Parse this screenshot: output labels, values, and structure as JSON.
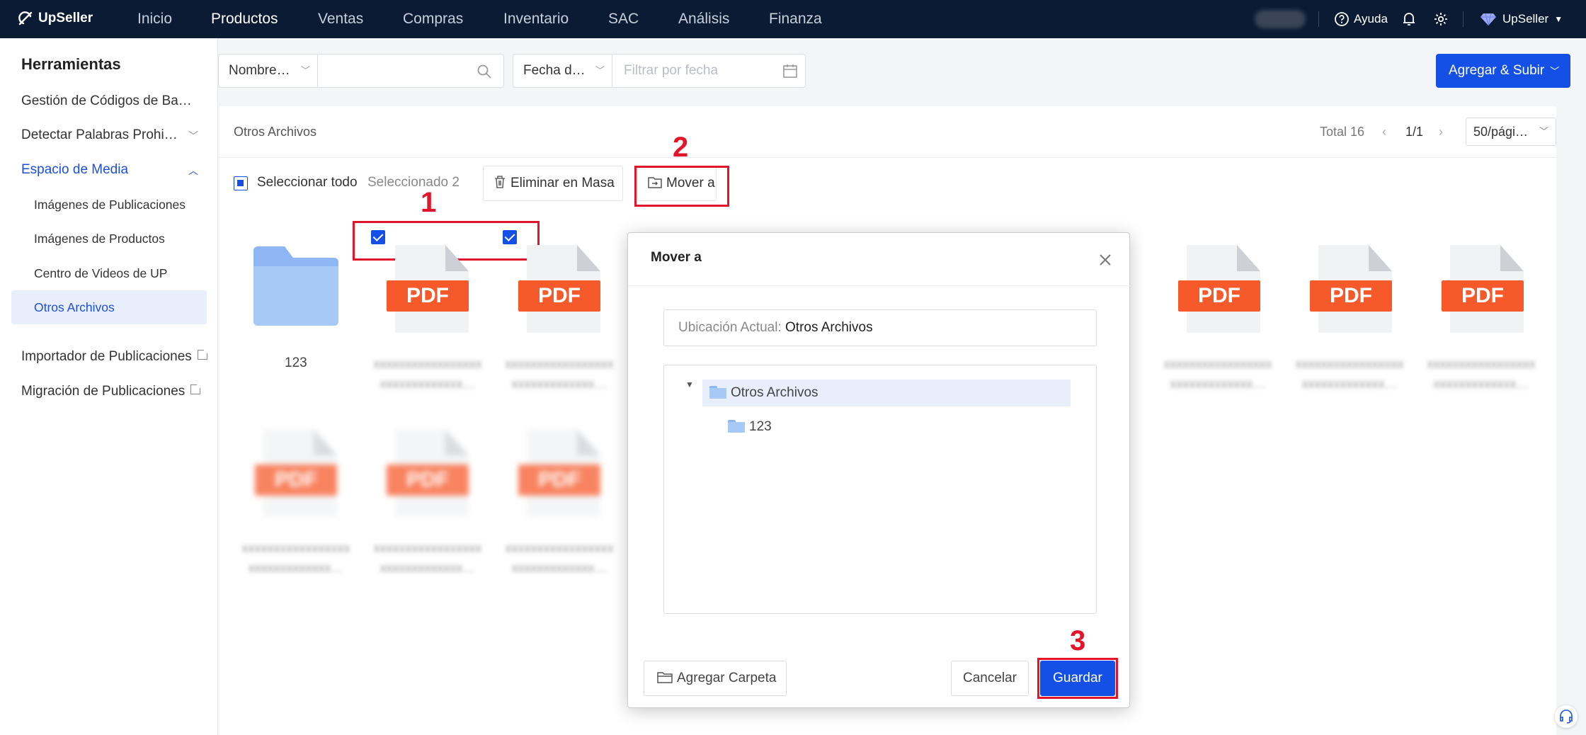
{
  "nav": {
    "brand": "UpSeller",
    "items": [
      {
        "label": "Inicio"
      },
      {
        "label": "Productos"
      },
      {
        "label": "Ventas"
      },
      {
        "label": "Compras"
      },
      {
        "label": "Inventario"
      },
      {
        "label": "SAC"
      },
      {
        "label": "Análisis"
      },
      {
        "label": "Finanza"
      }
    ],
    "active": "Productos",
    "help_label": "Ayuda",
    "account_label": "UpSeller"
  },
  "sidebar": {
    "title": "Herramientas",
    "items": [
      {
        "label": "Gestión de Códigos de Ba…"
      },
      {
        "label": "Detectar Palabras Prohi…"
      },
      {
        "label": "Espacio de Media"
      },
      {
        "label": "Importador de Publicaciones"
      },
      {
        "label": "Migración de Publicaciones"
      }
    ],
    "media_sub": [
      {
        "label": "Imágenes de Publicaciones"
      },
      {
        "label": "Imágenes de Productos"
      },
      {
        "label": "Centro de Videos de UP"
      },
      {
        "label": "Otros Archivos"
      }
    ]
  },
  "filters": {
    "name_select": "Nombre…",
    "date_select": "Fecha d…",
    "date_placeholder": "Filtrar por fecha",
    "add_button": "Agregar & Subir"
  },
  "panel": {
    "title": "Otros Archivos",
    "total": "Total 16",
    "page": "1/1",
    "per_page": "50/pági…",
    "select_all": "Seleccionar todo",
    "selected": "Seleccionado 2",
    "bulk_delete": "Eliminar en Masa",
    "move_to": "Mover a",
    "folder_name": "123",
    "pdf_label": "PDF"
  },
  "annotations": {
    "one": "1",
    "two": "2",
    "three": "3"
  },
  "modal": {
    "title": "Mover a",
    "current_label": "Ubicación Actual:",
    "current_value": "Otros Archivos",
    "tree_root": "Otros Archivos",
    "tree_child": "123",
    "add_folder": "Agregar Carpeta",
    "cancel": "Cancelar",
    "save": "Guardar"
  },
  "colors": {
    "primary": "#1450e6",
    "nav_bg": "#0b1b33",
    "annotation_red": "#e3152b",
    "pdf_orange": "#f65a2b"
  }
}
